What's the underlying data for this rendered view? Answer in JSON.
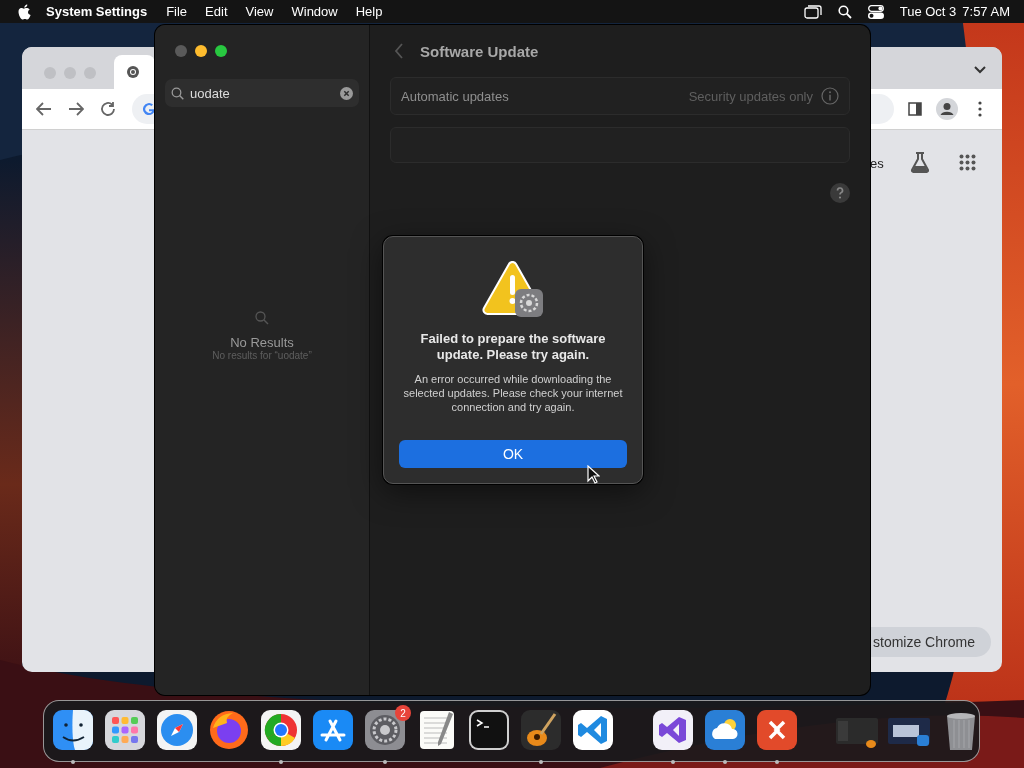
{
  "menu_bar": {
    "app_name": "System Settings",
    "menus": [
      "File",
      "Edit",
      "View",
      "Window",
      "Help"
    ],
    "clock": {
      "date": "Tue Oct 3",
      "time": "7:57 AM"
    }
  },
  "browser_window": {
    "toolbar_text": "es",
    "customize_button": "stomize Chrome"
  },
  "settings_window": {
    "search": {
      "value": "uodate"
    },
    "empty_state": {
      "title": "No Results",
      "subtitle": "No results for “uodate”"
    },
    "page_title": "Software Update",
    "rows": [
      {
        "label": "Automatic updates",
        "value": "Security updates only"
      }
    ]
  },
  "alert": {
    "title": "Failed to prepare the software update. Please try again.",
    "message": "An error occurred while downloading the selected updates. Please check your internet connection and try again.",
    "button": "OK"
  },
  "dock": {
    "sections": [
      {
        "items": [
          {
            "kind": "finder",
            "running": true
          },
          {
            "kind": "launchpad",
            "running": false
          },
          {
            "kind": "safari",
            "running": false
          },
          {
            "kind": "firefox",
            "running": false
          },
          {
            "kind": "chrome",
            "running": true
          },
          {
            "kind": "appstore",
            "running": false
          },
          {
            "kind": "settings",
            "running": true,
            "badge": "2"
          },
          {
            "kind": "textedit",
            "running": false
          },
          {
            "kind": "terminal",
            "running": false
          },
          {
            "kind": "garageband",
            "running": true
          },
          {
            "kind": "vscode",
            "running": false
          }
        ]
      },
      {
        "items": [
          {
            "kind": "visualstudio",
            "running": true
          },
          {
            "kind": "weather",
            "running": true
          },
          {
            "kind": "remote",
            "running": true
          }
        ]
      },
      {
        "items": [
          {
            "kind": "window-dark",
            "running": false
          },
          {
            "kind": "window-blue",
            "running": false
          },
          {
            "kind": "trash",
            "running": false
          }
        ]
      }
    ]
  }
}
